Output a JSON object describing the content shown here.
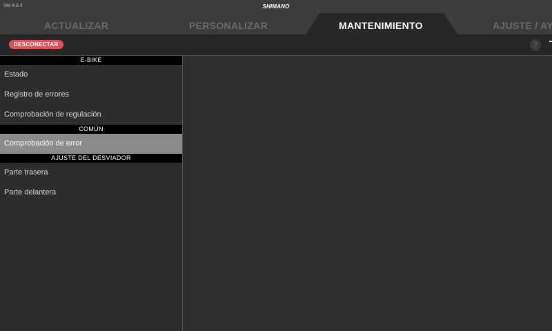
{
  "app": {
    "version": "Ver.4.0.4",
    "brand": "SHIMANO"
  },
  "tabs": [
    {
      "label": "ACTUALIZAR",
      "active": false
    },
    {
      "label": "PERSONALIZAR",
      "active": false
    },
    {
      "label": "MANTENIMIENTO",
      "active": true
    },
    {
      "label": "AJUSTE / AY",
      "active": false
    }
  ],
  "toolbar": {
    "disconnect_label": "DESCONECTAR",
    "help_icon": "?"
  },
  "sidebar": {
    "sections": [
      {
        "title": "E-BIKE",
        "items": [
          "Estado",
          "Registro de errores",
          "Comprobación de regulación"
        ]
      },
      {
        "title": "COMÚN",
        "items": [
          "Comprobación de error"
        ]
      },
      {
        "title": "AJUSTE DEL DESVIADOR",
        "items": [
          "Parte trasera",
          "Parte delantera"
        ]
      }
    ],
    "selected_item": "Comprobación de error"
  },
  "colors": {
    "accent": "#e2525b",
    "selected": "#8c8c8c",
    "background": "#2d2d2d"
  }
}
